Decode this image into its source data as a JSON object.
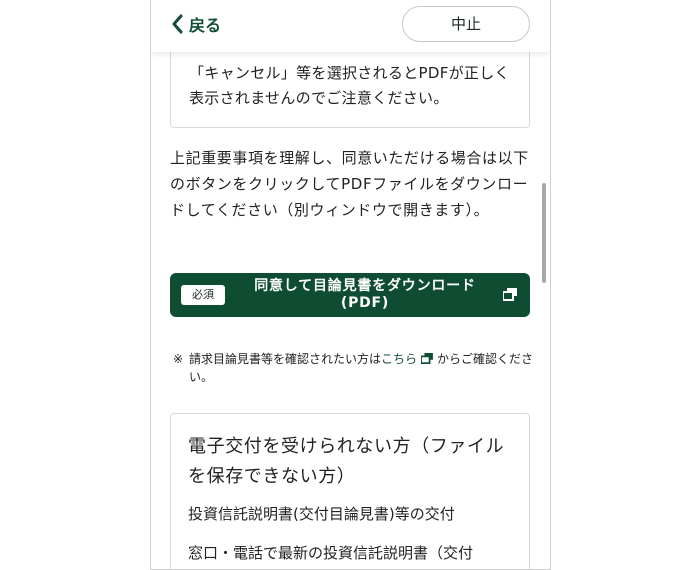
{
  "header": {
    "back_label": "戻る",
    "cancel_label": "中止"
  },
  "notice": {
    "text": "「キャンセル」等を選択されるとPDFが正しく表示されませんのでご注意ください。"
  },
  "instructions": {
    "text": "上記重要事項を理解し、同意いただける場合は以下のボタンをクリックしてPDFファイルをダウンロードしてください（別ウィンドウで開きます）。"
  },
  "download_button": {
    "badge": "必須",
    "line1": "同意して目論見書をダウンロード",
    "line2": "(PDF)"
  },
  "footnote": {
    "mark": "※",
    "before_link": "請求目論見書等を確認されたい方は",
    "link": "こちら",
    "after_link": "からご確認ください。"
  },
  "card": {
    "title": "電子交付を受けられない方（ファイルを保存できない方）",
    "subtitle": "投資信託説明書(交付目論見書)等の交付",
    "description": "窓口・電話で最新の投資信託説明書（交付"
  },
  "colors": {
    "brand_green": "#0e4d32"
  },
  "icons": {
    "back": "chevron-left-icon",
    "external_window": "new-window-icon"
  }
}
